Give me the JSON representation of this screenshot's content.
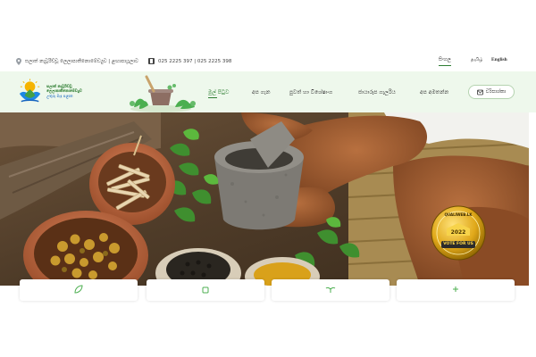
{
  "topbar": {
    "address": "සලාත් නැවූරිච්චූ ලෙලාපාතීනොමේඩ්‍යුව | ළඟාපායූලාව",
    "phone": "025 2225 397 | 025 2225 398",
    "languages": [
      "සිංහල",
      "தமிழ்",
      "English"
    ],
    "active_language": "සිංහල"
  },
  "logo": {
    "line1": "ඝලාත් නැවූරිච්චූ ලෙලාපාතීනොමේඩ්‍යුව",
    "line2": "උතුරු මැද පළාත"
  },
  "nav": {
    "items": [
      "මුල් පිටුව",
      "අප ගැන",
      "පුවත් හා විශේෂාංග",
      "ජායාරූප ගැලරිය",
      "අප අමතන්න"
    ],
    "contact_label": "ව්‍යිපාශ්කා"
  },
  "badge": {
    "top_text": "QUALIWEB.LK",
    "year": "2022",
    "bottom_text": "VOTE FOR US"
  },
  "colors": {
    "brand_green": "#2e7d32",
    "nav_bg": "#eef8ec",
    "badge_gold": "#d4a017"
  }
}
